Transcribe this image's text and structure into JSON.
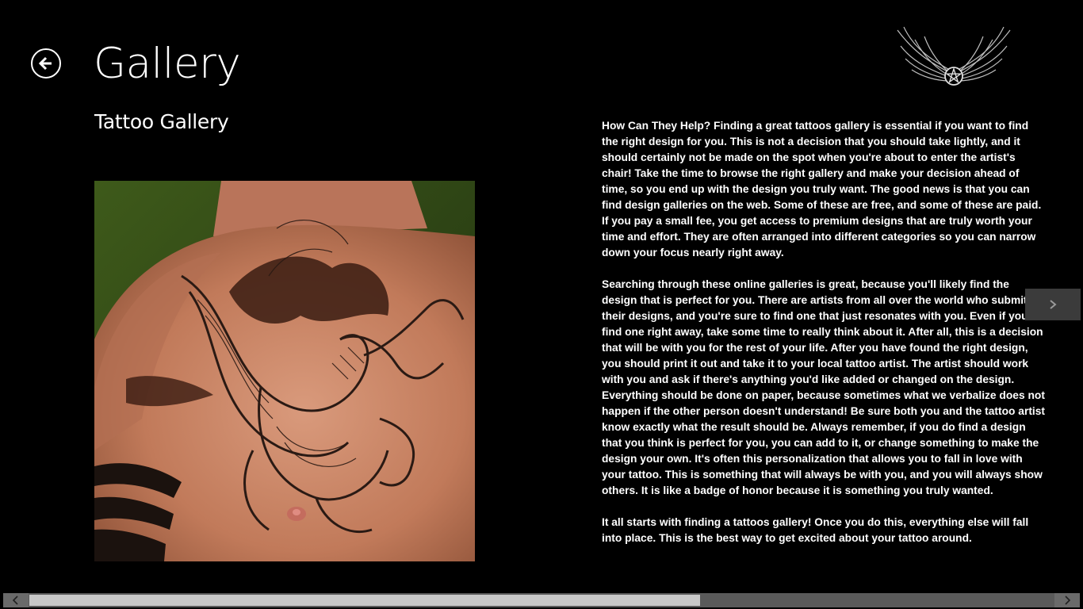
{
  "header": {
    "title": "Gallery",
    "subtitle": "Tattoo Gallery",
    "back_icon": "back-arrow-icon"
  },
  "logo": {
    "icon": "winged-pentagram-logo"
  },
  "image": {
    "description_icon": "tattoo-photo"
  },
  "article": {
    "paragraphs": [
      "How Can They Help? Finding a great tattoos gallery is essential if you want to find the right design for you. This is not a decision that you should take lightly, and it should certainly not be made on the spot when you're about to enter the artist's chair! Take the time to browse the right gallery and make your decision ahead of time, so you end up with the design you truly want. The good news is that you can find design galleries on the web. Some of these are free, and some of these are paid. If you pay a small fee, you get access to premium designs that are truly worth your time and effort. They are often arranged into different categories so you can narrow down your focus nearly right away.",
      "Searching through these online galleries is great, because you'll likely find the design that is perfect for you. There are artists from all over the world who submit their designs, and you're sure to find one that just resonates with you. Even if you do find one right away, take some time to really think about it. After all, this is a decision that will be with you for the rest of your life. After you have found the right design, you should print it out and take it to your local tattoo artist. The artist should work with you and ask if there's anything you'd like added or changed on the design. Everything should be done on paper, because sometimes what we verbalize does not happen if the other person doesn't understand! Be sure both you and the tattoo artist know exactly what the result should be. Always remember, if you do find a design that you think is perfect for you, you can add to it, or change something to make the design your own. It's often this personalization that allows you to fall in love with your tattoo. This is something that will always be with you, and you will always show others. It is like a badge of honor because it is something you truly wanted.",
      "It all starts with finding a tattoos gallery! Once you do this, everything else will fall into place. This is the best way to get excited about your tattoo around."
    ]
  },
  "navigation": {
    "next_icon": "chevron-right-icon"
  },
  "scrollbar": {
    "left_icon": "scroll-left-icon",
    "right_icon": "scroll-right-icon",
    "position": 0.62
  },
  "colors": {
    "background": "#000000",
    "text": "#ffffff",
    "next_button": "#3b3b3b",
    "scrollbar_track": "#5a5a5a",
    "scrollbar_thumb": "#c8c8c8"
  }
}
